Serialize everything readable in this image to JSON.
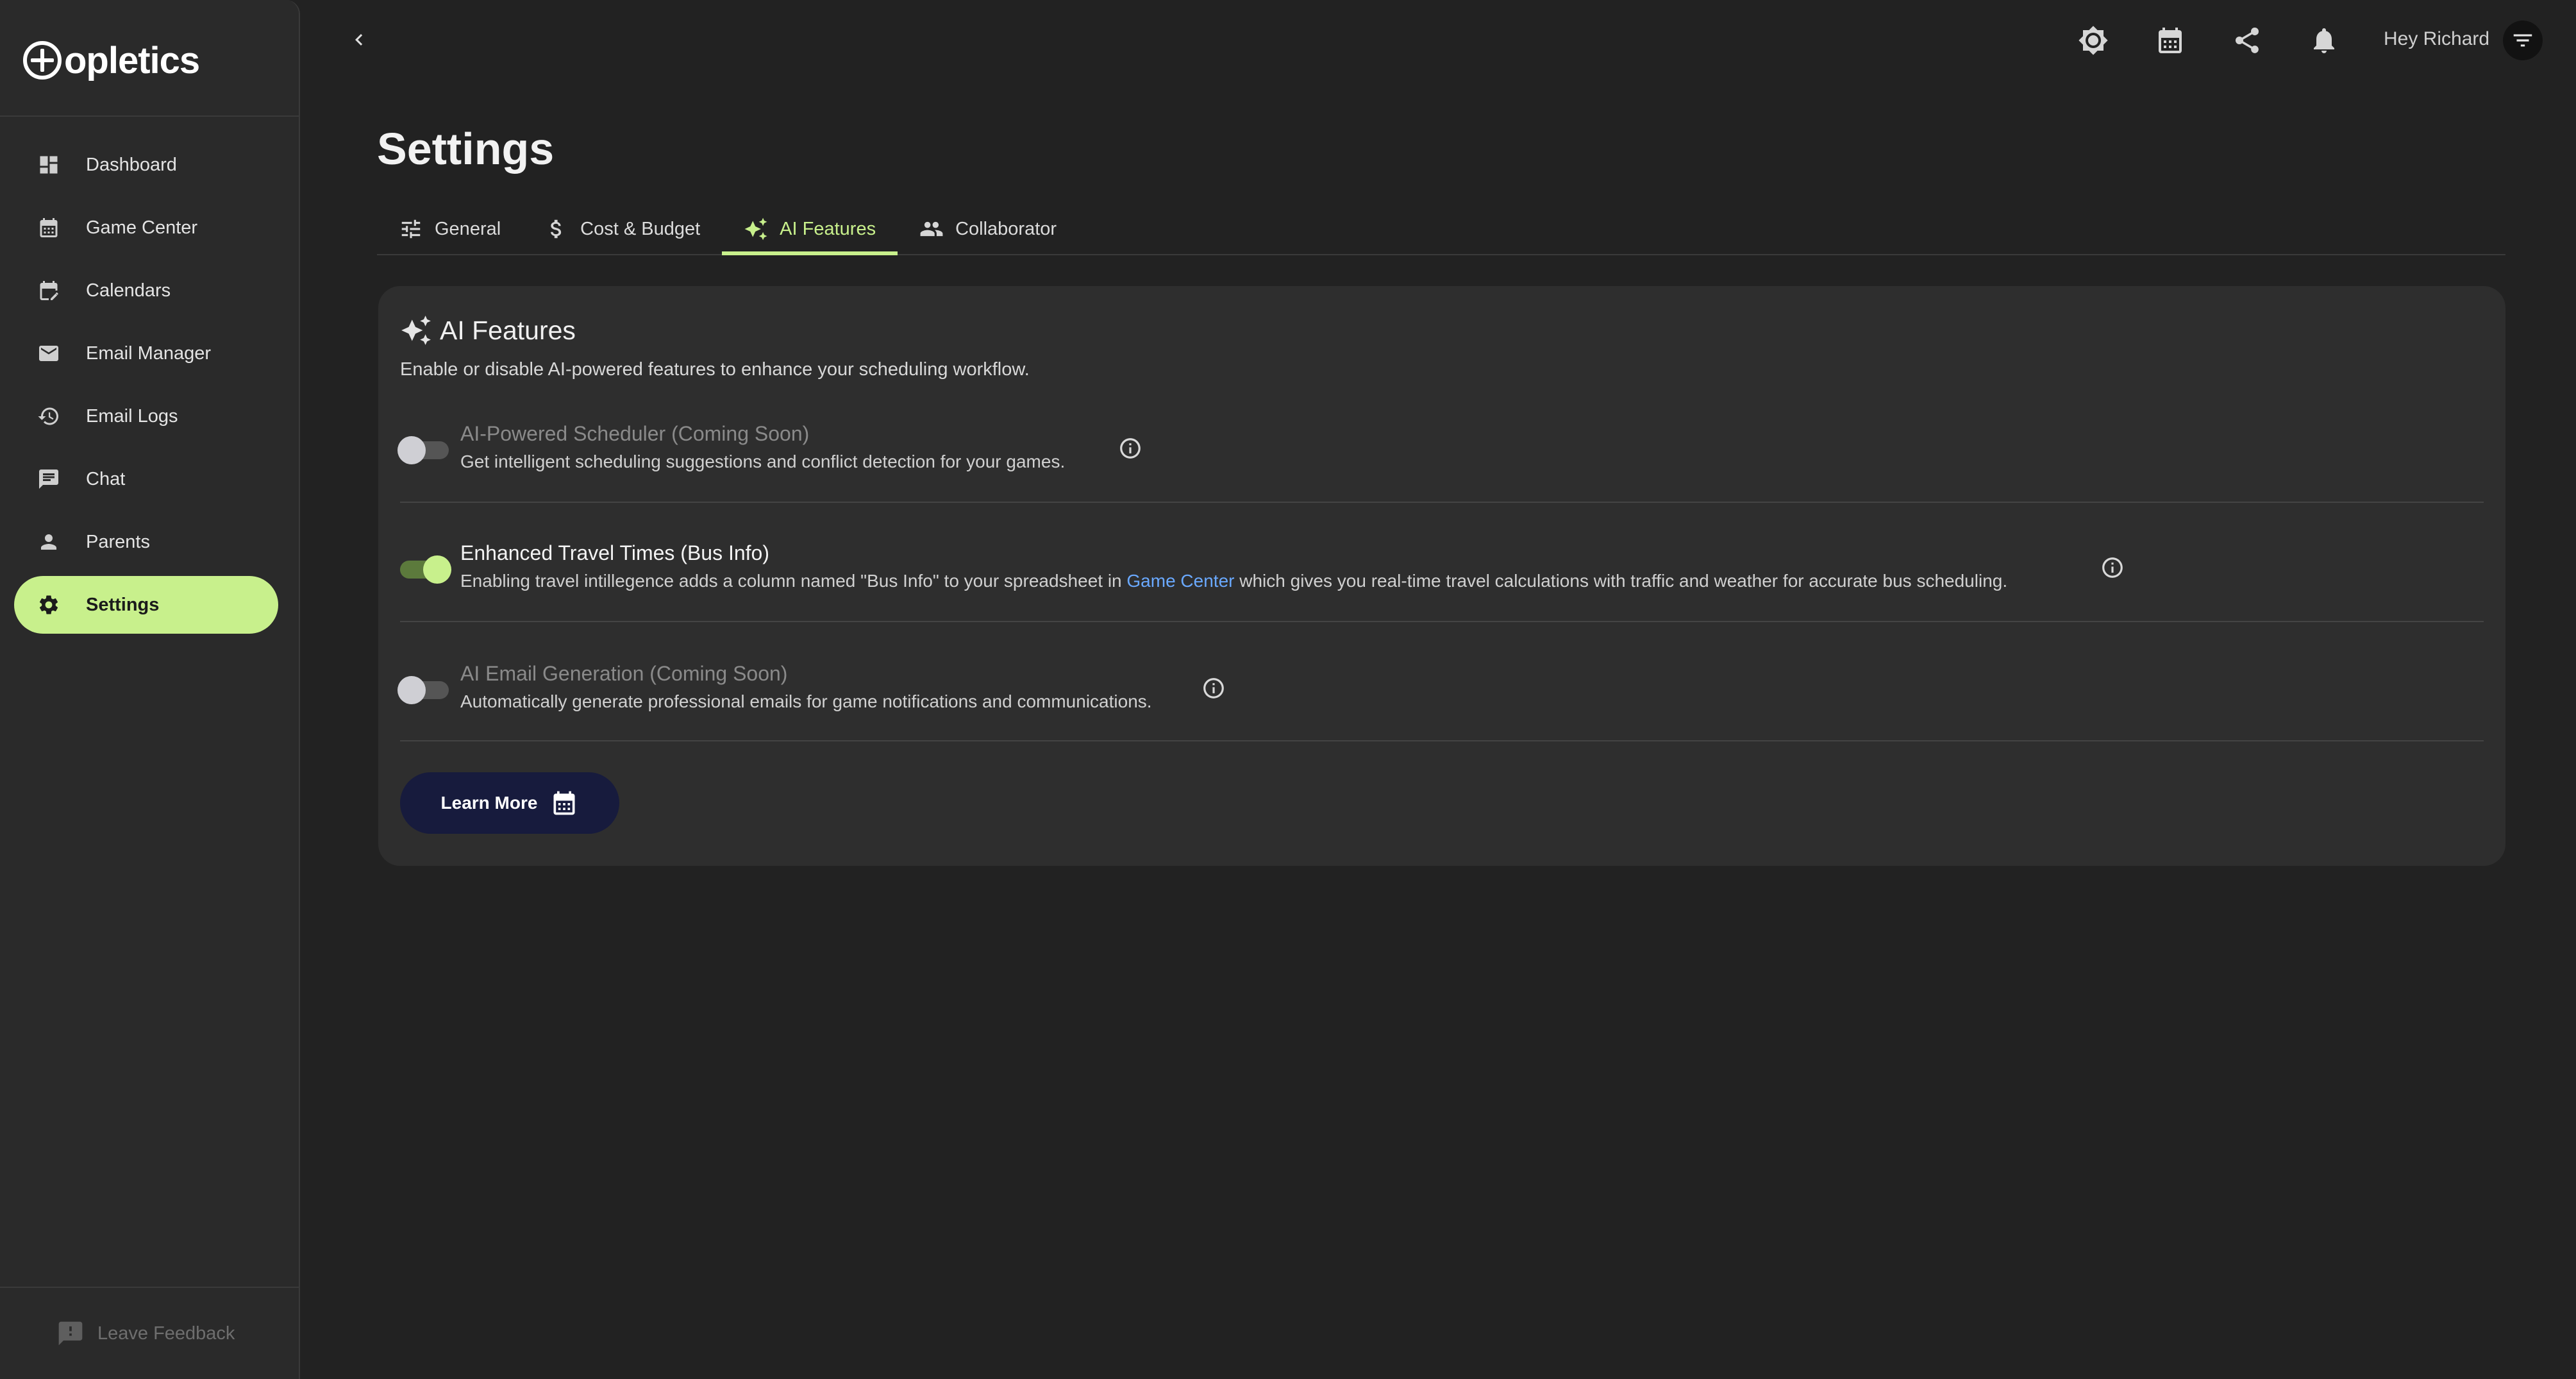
{
  "brand": {
    "logo_text": "opletics"
  },
  "sidebar": {
    "items": [
      {
        "label": "Dashboard",
        "icon": "dashboard-icon"
      },
      {
        "label": "Game Center",
        "icon": "calendar-grid-icon"
      },
      {
        "label": "Calendars",
        "icon": "calendar-edit-icon"
      },
      {
        "label": "Email Manager",
        "icon": "mail-icon"
      },
      {
        "label": "Email Logs",
        "icon": "history-icon"
      },
      {
        "label": "Chat",
        "icon": "chat-icon"
      },
      {
        "label": "Parents",
        "icon": "person-icon"
      },
      {
        "label": "Settings",
        "icon": "gear-icon",
        "active": true
      }
    ],
    "feedback_label": "Leave Feedback"
  },
  "header": {
    "greeting": "Hey Richard",
    "icons": [
      "brightness-icon",
      "calendar-icon",
      "share-icon",
      "bell-icon"
    ]
  },
  "page": {
    "title": "Settings"
  },
  "tabs": [
    {
      "label": "General",
      "icon": "tune-icon"
    },
    {
      "label": "Cost & Budget",
      "icon": "dollar-icon"
    },
    {
      "label": "AI Features",
      "icon": "sparkle-icon",
      "active": true
    },
    {
      "label": "Collaborator",
      "icon": "people-icon"
    }
  ],
  "card": {
    "title": "AI Features",
    "description": "Enable or disable AI-powered features to enhance your scheduling workflow.",
    "features": [
      {
        "title": "AI-Powered Scheduler (Coming Soon)",
        "subtitle": "Get intelligent scheduling suggestions and conflict detection for your games.",
        "enabled": false,
        "disabled": true
      },
      {
        "title": "Enhanced Travel Times (Bus Info)",
        "subtitle_before": "Enabling travel intillegence adds a column named \"Bus Info\" to your spreadsheet in",
        "subtitle_link": "Game Center",
        "subtitle_after": "which gives you real-time travel calculations with traffic and weather for accurate bus scheduling.",
        "enabled": true,
        "disabled": false
      },
      {
        "title": "AI Email Generation (Coming Soon)",
        "subtitle": "Automatically generate professional emails for game notifications and communications.",
        "enabled": false,
        "disabled": true
      }
    ],
    "button_label": "Learn More"
  },
  "colors": {
    "accent": "#c8f08c",
    "link": "#6aa9ff",
    "button_bg": "#171b3d",
    "background": "#222222",
    "sidebar_bg": "#2a2a2a",
    "card_bg": "#2e2e2e"
  }
}
